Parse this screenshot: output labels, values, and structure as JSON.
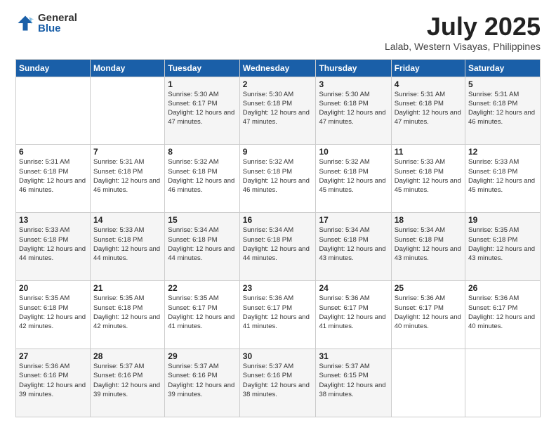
{
  "logo": {
    "general": "General",
    "blue": "Blue"
  },
  "header": {
    "month": "July 2025",
    "location": "Lalab, Western Visayas, Philippines"
  },
  "weekdays": [
    "Sunday",
    "Monday",
    "Tuesday",
    "Wednesday",
    "Thursday",
    "Friday",
    "Saturday"
  ],
  "weeks": [
    [
      {
        "day": "",
        "info": ""
      },
      {
        "day": "",
        "info": ""
      },
      {
        "day": "1",
        "info": "Sunrise: 5:30 AM\nSunset: 6:17 PM\nDaylight: 12 hours and 47 minutes."
      },
      {
        "day": "2",
        "info": "Sunrise: 5:30 AM\nSunset: 6:18 PM\nDaylight: 12 hours and 47 minutes."
      },
      {
        "day": "3",
        "info": "Sunrise: 5:30 AM\nSunset: 6:18 PM\nDaylight: 12 hours and 47 minutes."
      },
      {
        "day": "4",
        "info": "Sunrise: 5:31 AM\nSunset: 6:18 PM\nDaylight: 12 hours and 47 minutes."
      },
      {
        "day": "5",
        "info": "Sunrise: 5:31 AM\nSunset: 6:18 PM\nDaylight: 12 hours and 46 minutes."
      }
    ],
    [
      {
        "day": "6",
        "info": "Sunrise: 5:31 AM\nSunset: 6:18 PM\nDaylight: 12 hours and 46 minutes."
      },
      {
        "day": "7",
        "info": "Sunrise: 5:31 AM\nSunset: 6:18 PM\nDaylight: 12 hours and 46 minutes."
      },
      {
        "day": "8",
        "info": "Sunrise: 5:32 AM\nSunset: 6:18 PM\nDaylight: 12 hours and 46 minutes."
      },
      {
        "day": "9",
        "info": "Sunrise: 5:32 AM\nSunset: 6:18 PM\nDaylight: 12 hours and 46 minutes."
      },
      {
        "day": "10",
        "info": "Sunrise: 5:32 AM\nSunset: 6:18 PM\nDaylight: 12 hours and 45 minutes."
      },
      {
        "day": "11",
        "info": "Sunrise: 5:33 AM\nSunset: 6:18 PM\nDaylight: 12 hours and 45 minutes."
      },
      {
        "day": "12",
        "info": "Sunrise: 5:33 AM\nSunset: 6:18 PM\nDaylight: 12 hours and 45 minutes."
      }
    ],
    [
      {
        "day": "13",
        "info": "Sunrise: 5:33 AM\nSunset: 6:18 PM\nDaylight: 12 hours and 44 minutes."
      },
      {
        "day": "14",
        "info": "Sunrise: 5:33 AM\nSunset: 6:18 PM\nDaylight: 12 hours and 44 minutes."
      },
      {
        "day": "15",
        "info": "Sunrise: 5:34 AM\nSunset: 6:18 PM\nDaylight: 12 hours and 44 minutes."
      },
      {
        "day": "16",
        "info": "Sunrise: 5:34 AM\nSunset: 6:18 PM\nDaylight: 12 hours and 44 minutes."
      },
      {
        "day": "17",
        "info": "Sunrise: 5:34 AM\nSunset: 6:18 PM\nDaylight: 12 hours and 43 minutes."
      },
      {
        "day": "18",
        "info": "Sunrise: 5:34 AM\nSunset: 6:18 PM\nDaylight: 12 hours and 43 minutes."
      },
      {
        "day": "19",
        "info": "Sunrise: 5:35 AM\nSunset: 6:18 PM\nDaylight: 12 hours and 43 minutes."
      }
    ],
    [
      {
        "day": "20",
        "info": "Sunrise: 5:35 AM\nSunset: 6:18 PM\nDaylight: 12 hours and 42 minutes."
      },
      {
        "day": "21",
        "info": "Sunrise: 5:35 AM\nSunset: 6:18 PM\nDaylight: 12 hours and 42 minutes."
      },
      {
        "day": "22",
        "info": "Sunrise: 5:35 AM\nSunset: 6:17 PM\nDaylight: 12 hours and 41 minutes."
      },
      {
        "day": "23",
        "info": "Sunrise: 5:36 AM\nSunset: 6:17 PM\nDaylight: 12 hours and 41 minutes."
      },
      {
        "day": "24",
        "info": "Sunrise: 5:36 AM\nSunset: 6:17 PM\nDaylight: 12 hours and 41 minutes."
      },
      {
        "day": "25",
        "info": "Sunrise: 5:36 AM\nSunset: 6:17 PM\nDaylight: 12 hours and 40 minutes."
      },
      {
        "day": "26",
        "info": "Sunrise: 5:36 AM\nSunset: 6:17 PM\nDaylight: 12 hours and 40 minutes."
      }
    ],
    [
      {
        "day": "27",
        "info": "Sunrise: 5:36 AM\nSunset: 6:16 PM\nDaylight: 12 hours and 39 minutes."
      },
      {
        "day": "28",
        "info": "Sunrise: 5:37 AM\nSunset: 6:16 PM\nDaylight: 12 hours and 39 minutes."
      },
      {
        "day": "29",
        "info": "Sunrise: 5:37 AM\nSunset: 6:16 PM\nDaylight: 12 hours and 39 minutes."
      },
      {
        "day": "30",
        "info": "Sunrise: 5:37 AM\nSunset: 6:16 PM\nDaylight: 12 hours and 38 minutes."
      },
      {
        "day": "31",
        "info": "Sunrise: 5:37 AM\nSunset: 6:15 PM\nDaylight: 12 hours and 38 minutes."
      },
      {
        "day": "",
        "info": ""
      },
      {
        "day": "",
        "info": ""
      }
    ]
  ]
}
